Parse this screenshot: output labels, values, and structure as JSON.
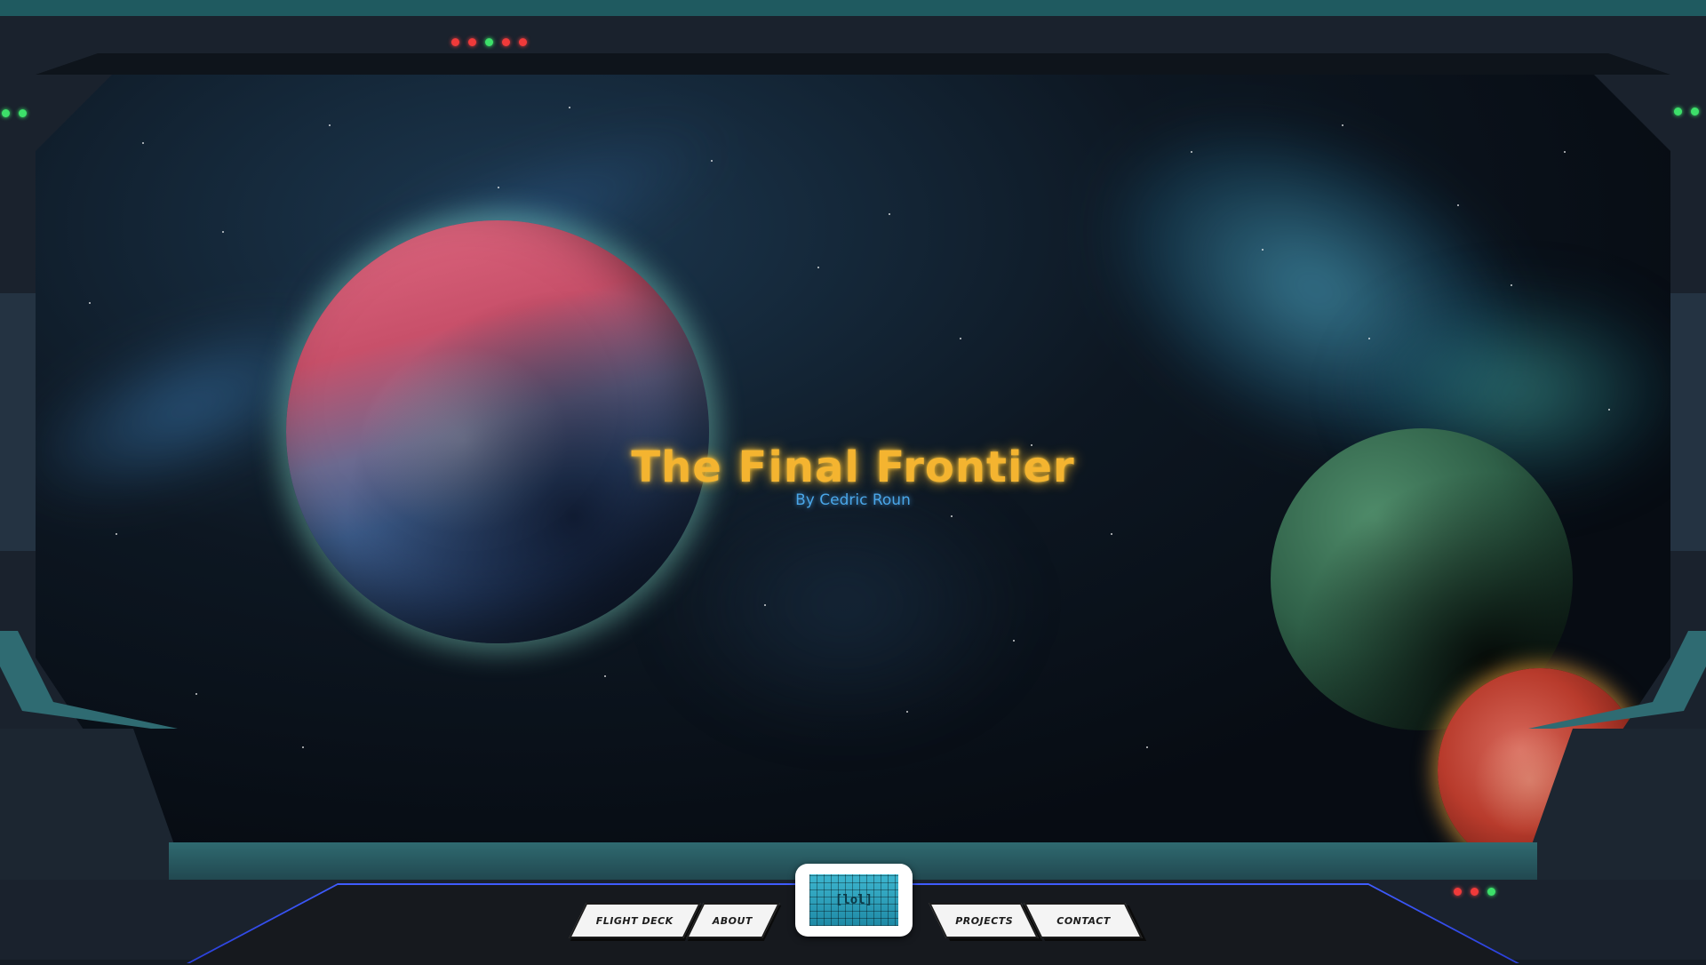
{
  "hero": {
    "title": "The Final Frontier",
    "subtitle": "By Cedric Roun"
  },
  "nav": {
    "items": [
      "FLIGHT DECK",
      "ABOUT",
      "PROJECTS",
      "CONTACT"
    ],
    "center_label": "[lol]"
  },
  "indicators": {
    "top_center": [
      "red",
      "red",
      "green",
      "red",
      "red"
    ],
    "top_left": [
      "green",
      "green"
    ],
    "top_right": [
      "green",
      "green"
    ],
    "bottom_right": [
      "red",
      "red",
      "green"
    ]
  },
  "colors": {
    "title": "#f4b430",
    "subtitle": "#4aa6e8",
    "frame_teal": "#2f6b72",
    "console_glow": "#3f5cff"
  },
  "icons": {
    "center_pad": "hologram-screen-icon"
  }
}
